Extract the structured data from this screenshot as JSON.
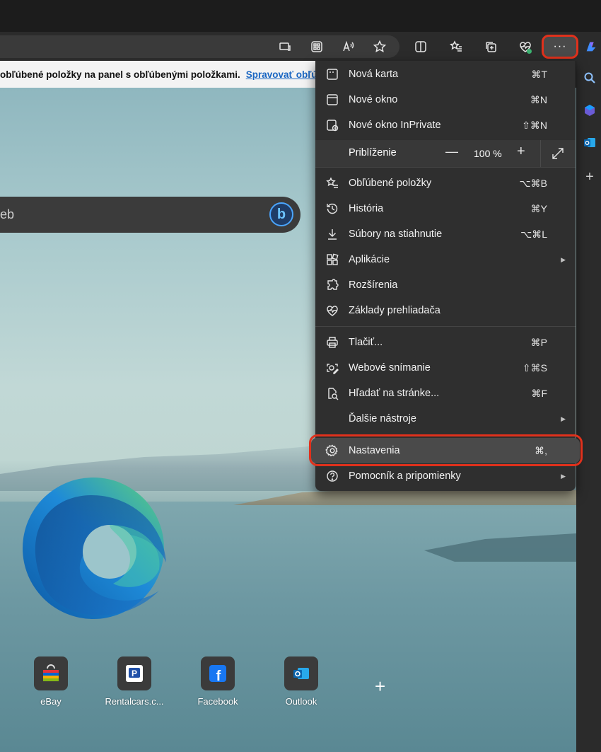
{
  "toolbar": {
    "more_label": "···",
    "icons": [
      "app-view-icon",
      "apps-grid-icon",
      "read-aloud-icon",
      "favorite-star-icon",
      "split-screen-icon",
      "favorites-list-icon",
      "collections-icon",
      "browser-essentials-icon",
      "more-icon"
    ]
  },
  "favbar": {
    "text": "obľúbené položky na panel s obľúbenými položkami.",
    "link": "Spravovať obľú"
  },
  "search": {
    "placeholder_fragment": "eb"
  },
  "menu": {
    "items": [
      {
        "label": "Nová karta",
        "shortcut": "⌘T",
        "icon": "new-tab-icon"
      },
      {
        "label": "Nové okno",
        "shortcut": "⌘N",
        "icon": "new-window-icon"
      },
      {
        "label": "Nové okno InPrivate",
        "shortcut": "⇧⌘N",
        "icon": "inprivate-icon"
      },
      {
        "label": "Obľúbené položky",
        "shortcut": "⌥⌘B",
        "icon": "favorites-icon"
      },
      {
        "label": "História",
        "shortcut": "⌘Y",
        "icon": "history-icon"
      },
      {
        "label": "Súbory na stiahnutie",
        "shortcut": "⌥⌘L",
        "icon": "download-icon"
      },
      {
        "label": "Aplikácie",
        "shortcut": "",
        "icon": "apps-icon",
        "submenu": true
      },
      {
        "label": "Rozšírenia",
        "shortcut": "",
        "icon": "extensions-icon"
      },
      {
        "label": "Základy prehliadača",
        "shortcut": "",
        "icon": "heartbeat-icon"
      },
      {
        "label": "Tlačiť...",
        "shortcut": "⌘P",
        "icon": "print-icon"
      },
      {
        "label": "Webové snímanie",
        "shortcut": "⇧⌘S",
        "icon": "web-capture-icon"
      },
      {
        "label": "Hľadať na stránke...",
        "shortcut": "⌘F",
        "icon": "find-icon"
      },
      {
        "label": "Ďalšie nástroje",
        "shortcut": "",
        "icon": "",
        "submenu": true
      },
      {
        "label": "Nastavenia",
        "shortcut": "⌘,",
        "icon": "settings-gear-icon"
      },
      {
        "label": "Pomocník a pripomienky",
        "shortcut": "",
        "icon": "help-icon",
        "submenu": true
      }
    ],
    "zoom": {
      "label": "Priblíženie",
      "value": "100 %",
      "minus": "—",
      "plus": "+"
    }
  },
  "tiles": [
    {
      "label": "eBay",
      "icon": "ebay-icon"
    },
    {
      "label": "Rentalcars.c...",
      "icon": "rentalcars-icon"
    },
    {
      "label": "Facebook",
      "icon": "facebook-icon"
    },
    {
      "label": "Outlook",
      "icon": "outlook-icon"
    }
  ],
  "add_tile": "+",
  "colors": {
    "highlight_ring": "#e0311c",
    "menu_bg": "#2f2f2f",
    "link": "#1a66c2"
  }
}
